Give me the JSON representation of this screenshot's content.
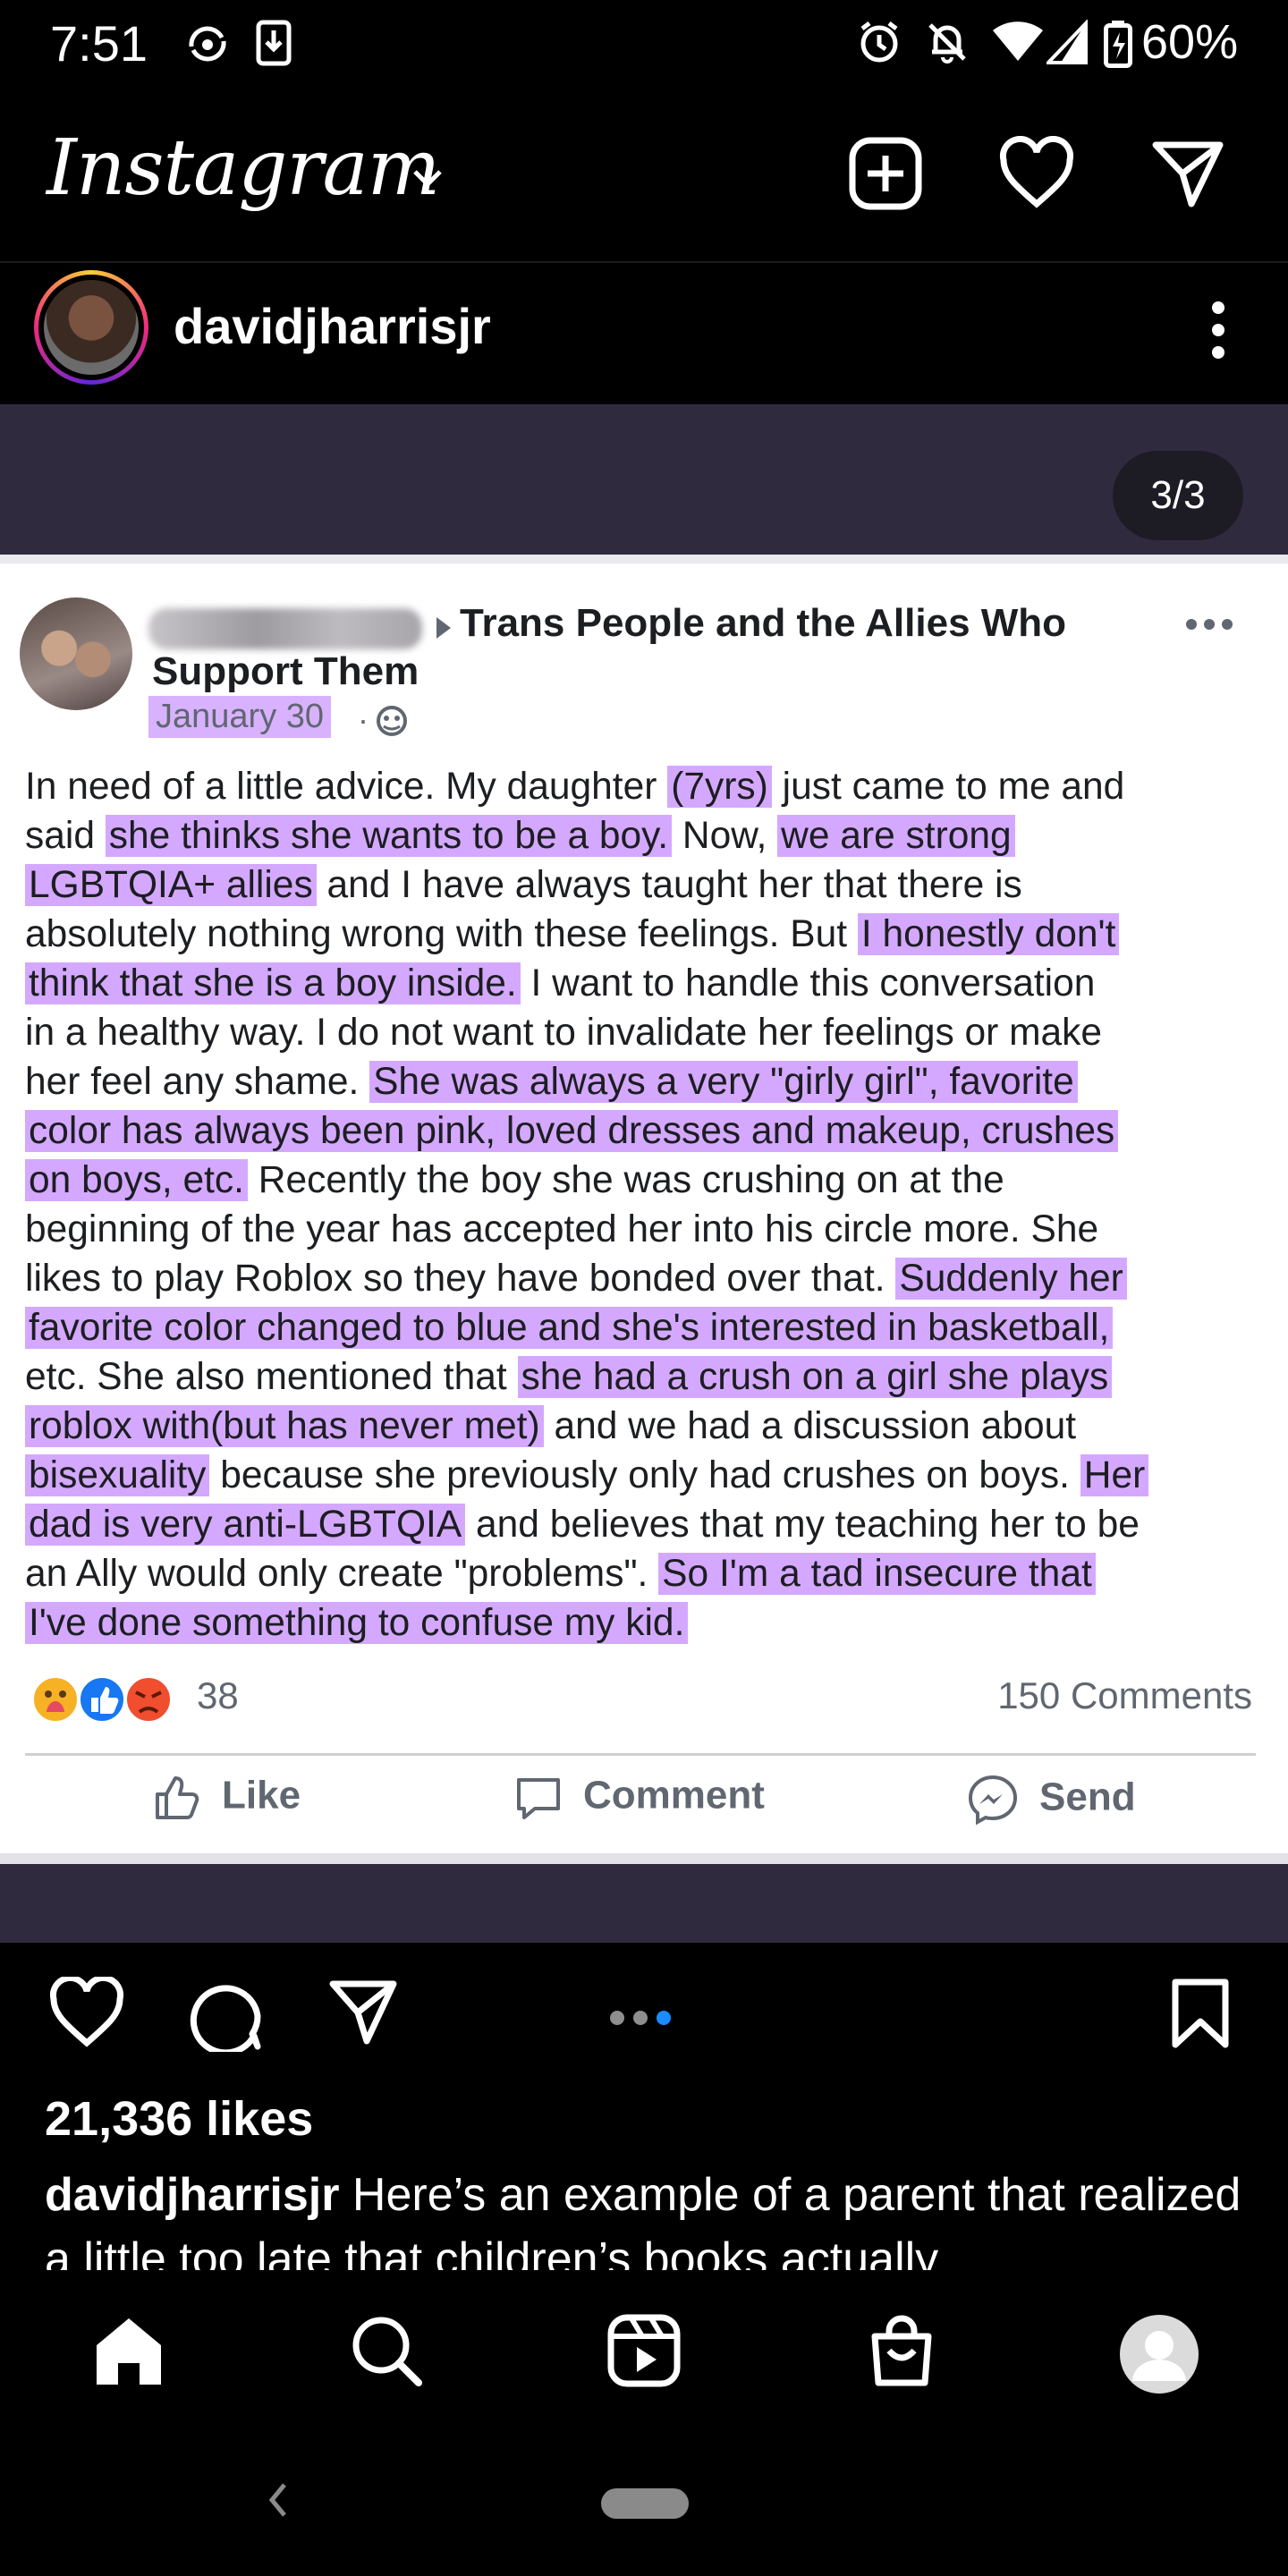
{
  "status_bar": {
    "time": "7:51",
    "battery": "60%",
    "icons": [
      "sync-icon",
      "download-icon",
      "alarm-icon",
      "bell-off-icon",
      "wifi-icon",
      "signal-icon",
      "battery-icon"
    ]
  },
  "header": {
    "app_name": "Instagram",
    "icons": [
      "chevron-down-icon",
      "plus-square-icon",
      "heart-icon",
      "send-icon"
    ]
  },
  "post": {
    "username": "davidjharrisjr",
    "carousel_counter": "3/3",
    "likes": "21,336 likes",
    "caption_user": "davidjharrisjr",
    "caption_text": "Here’s an example of a parent that realized a little too late that children’s books actually"
  },
  "facebook_card": {
    "group_line1": "Trans People and the Allies Who",
    "group_line2": "Support Them",
    "date": "January 30",
    "separator": "·",
    "reaction_count": "38",
    "comments": "150 Comments",
    "actions": {
      "like": "Like",
      "comment": "Comment",
      "send": "Send"
    },
    "lines": [
      [
        {
          "t": "In need of a little advice. My daughter "
        },
        {
          "t": "(7yrs)",
          "h": true
        },
        {
          "t": " just came to me and"
        }
      ],
      [
        {
          "t": "said "
        },
        {
          "t": "she thinks she wants to be a boy.",
          "h": true
        },
        {
          "t": " Now, "
        },
        {
          "t": "we are strong",
          "h": true
        }
      ],
      [
        {
          "t": "LGBTQIA+ allies",
          "h": true
        },
        {
          "t": " and I have always taught her that there is"
        }
      ],
      [
        {
          "t": "absolutely nothing wrong with these feelings. But "
        },
        {
          "t": "I honestly don't",
          "h": true
        }
      ],
      [
        {
          "t": "think that she is a boy inside.",
          "h": true
        },
        {
          "t": " I want to handle this conversation"
        }
      ],
      [
        {
          "t": "in a healthy way. I do not want to invalidate her feelings or make"
        }
      ],
      [
        {
          "t": "her feel any shame. "
        },
        {
          "t": "She was always a very \"girly girl\", favorite",
          "h": true
        }
      ],
      [
        {
          "t": "color has always been pink, loved dresses and makeup, crushes",
          "h": true
        }
      ],
      [
        {
          "t": "on boys, etc.",
          "h": true
        },
        {
          "t": " Recently the boy she was crushing on at the"
        }
      ],
      [
        {
          "t": "beginning of the year has accepted her into his circle more. She"
        }
      ],
      [
        {
          "t": "likes to play Roblox so they have bonded over that. "
        },
        {
          "t": "Suddenly her",
          "h": true
        }
      ],
      [
        {
          "t": "favorite color changed to blue and she's interested in basketball,",
          "h": true
        }
      ],
      [
        {
          "t": "etc. She also mentioned that "
        },
        {
          "t": "she had a crush on a girl she plays",
          "h": true
        }
      ],
      [
        {
          "t": "roblox with(but has never met)",
          "h": true
        },
        {
          "t": " and we had a discussion about"
        }
      ],
      [
        {
          "t": "bisexuality",
          "h": true
        },
        {
          "t": " because she previously only had crushes on boys. "
        },
        {
          "t": "Her",
          "h": true
        }
      ],
      [
        {
          "t": "dad is very anti-LGBTQIA",
          "h": true
        },
        {
          "t": " and believes that my teaching her to be"
        }
      ],
      [
        {
          "t": "an Ally would only create \"problems\". "
        },
        {
          "t": "So I'm a tad insecure that",
          "h": true
        }
      ],
      [
        {
          "t": "I've done something to confuse my kid.",
          "h": true
        }
      ]
    ]
  },
  "colors": {
    "highlight": "#d4a8ff",
    "media_bg": "#302a3f",
    "accent_dot": "#1a8cff"
  },
  "bottom_nav": [
    "home-icon",
    "search-icon",
    "reels-icon",
    "shop-icon",
    "profile-icon"
  ]
}
